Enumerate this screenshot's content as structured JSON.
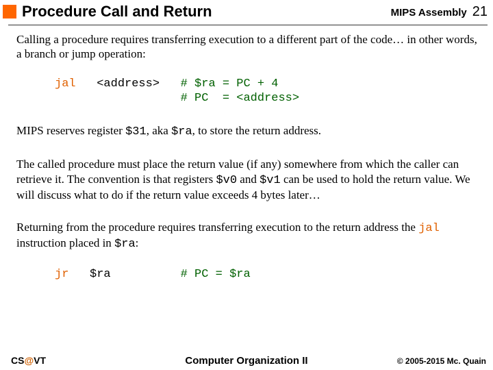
{
  "header": {
    "title": "Procedure Call and Return",
    "section": "MIPS Assembly",
    "page": "21"
  },
  "body": {
    "p1": "Calling a procedure requires transferring execution to a different part of the code… in other words, a branch or jump operation:",
    "code1": {
      "kw": "jal",
      "arg": "<address>",
      "c1": "# $ra = PC + 4",
      "c2": "# PC  = <address>"
    },
    "p2a": "MIPS reserves register ",
    "p2b": "$31",
    "p2c": ", aka ",
    "p2d": "$ra",
    "p2e": ", to store the return address.",
    "p3a": "The called procedure must place the return value (if any) somewhere from which the caller can retrieve it.  The convention is that registers ",
    "p3b": "$v0",
    "p3c": " and ",
    "p3d": "$v1",
    "p3e": " can be used to hold the return value.  We will discuss what to do if the return value exceeds 4 bytes later…",
    "p4a": "Returning from the procedure requires transferring execution to the return address the ",
    "p4b": "jal",
    "p4c": " instruction placed in ",
    "p4d": "$ra",
    "p4e": ":",
    "code2": {
      "kw": "jr",
      "arg": "$ra",
      "c1": "# PC = $ra"
    }
  },
  "footer": {
    "left_cs": "CS",
    "left_at": "@",
    "left_vt": "VT",
    "center": "Computer Organization II",
    "right": "© 2005-2015 Mc. Quain"
  }
}
